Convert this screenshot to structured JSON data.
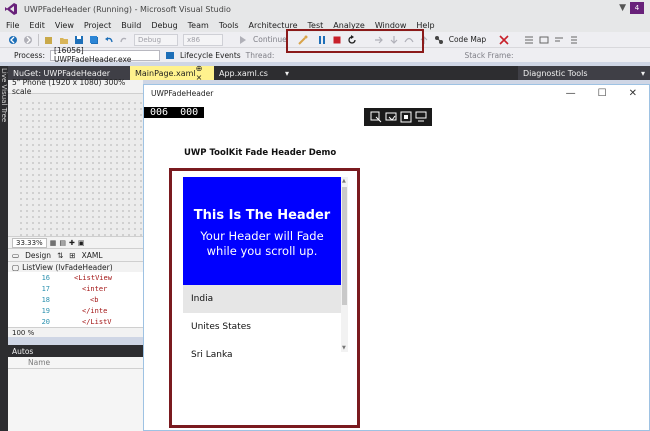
{
  "window": {
    "title": "UWPFadeHeader (Running) - Microsoft Visual Studio",
    "notification_count": "4"
  },
  "menu": [
    "File",
    "Edit",
    "View",
    "Project",
    "Build",
    "Debug",
    "Team",
    "Tools",
    "Architecture",
    "Test",
    "Analyze",
    "Window",
    "Help"
  ],
  "toolbar": {
    "config": "Debug",
    "platform": "x86",
    "continue_label": "Continue",
    "code_map_label": "Code Map",
    "process_label": "Process:",
    "process_value": "[16056] UWPFadeHeader.exe",
    "lifecycle_label": "Lifecycle Events",
    "thread_label": "Thread:",
    "stack_frame_label": "Stack Frame:"
  },
  "sidebar": {
    "live_visual_tree": "Live Visual Tree"
  },
  "tabs": [
    {
      "label": "NuGet: UWPFadeHeader"
    },
    {
      "label": "MainPage.xaml"
    },
    {
      "label": "App.xaml.cs"
    }
  ],
  "diagnostic_tab": "Diagnostic Tools",
  "designer": {
    "device": "5\" Phone (1920 x 1080) 300% scale",
    "zoom": "33.33%",
    "design_tab": "Design",
    "xaml_tab": "XAML",
    "listview_label": "ListView (lvFadeHeader)",
    "code_lines": [
      {
        "num": "16",
        "text": "<ListView"
      },
      {
        "num": "17",
        "text": "<inter"
      },
      {
        "num": "18",
        "text": "<b"
      },
      {
        "num": "19",
        "text": "</inte"
      },
      {
        "num": "20",
        "text": "</ListV"
      }
    ],
    "code_zoom": "100 %"
  },
  "autos": {
    "title": "Autos",
    "col_name": "Name"
  },
  "app": {
    "title": "UWPFadeHeader",
    "counter_a": "006",
    "counter_b": "000",
    "demo_title": "UWP ToolKit Fade Header Demo",
    "header_title": "This Is The Header",
    "header_sub_1": "Your Header will Fade",
    "header_sub_2": "while you scroll up.",
    "list_items": [
      "India",
      "Unites States",
      "Sri Lanka"
    ],
    "header_color": "#0000ff",
    "frame_color": "#7a1a1f"
  }
}
